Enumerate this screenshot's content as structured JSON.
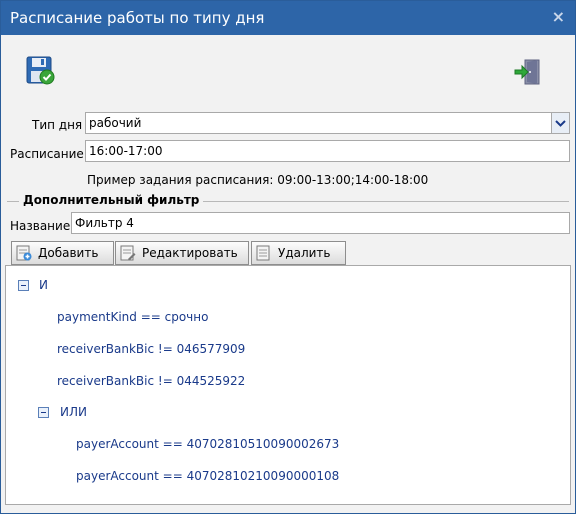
{
  "window": {
    "title": "Расписание работы по типу дня",
    "close": "×"
  },
  "toolbar": {
    "save_icon": "save-icon",
    "exit_icon": "exit-icon"
  },
  "form": {
    "day_type_label": "Тип дня",
    "day_type_value": "рабочий",
    "schedule_label": "Расписание",
    "schedule_value": "16:00-17:00",
    "example_text": "Пример задания расписания: 09:00-13:00;14:00-18:00"
  },
  "filter": {
    "section_title": "Дополнительный фильтр",
    "name_label": "Название",
    "name_value": "Фильтр 4",
    "buttons": {
      "add": "Добавить",
      "edit": "Редактировать",
      "delete": "Удалить"
    }
  },
  "tree": {
    "root": "И",
    "conditions": [
      "paymentKind == срочно",
      "receiverBankBic != 046577909",
      "receiverBankBic != 044525922"
    ],
    "or_node": "ИЛИ",
    "or_conditions": [
      "payerAccount == 40702810510090002673",
      "payerAccount == 40702810210090000108"
    ]
  }
}
